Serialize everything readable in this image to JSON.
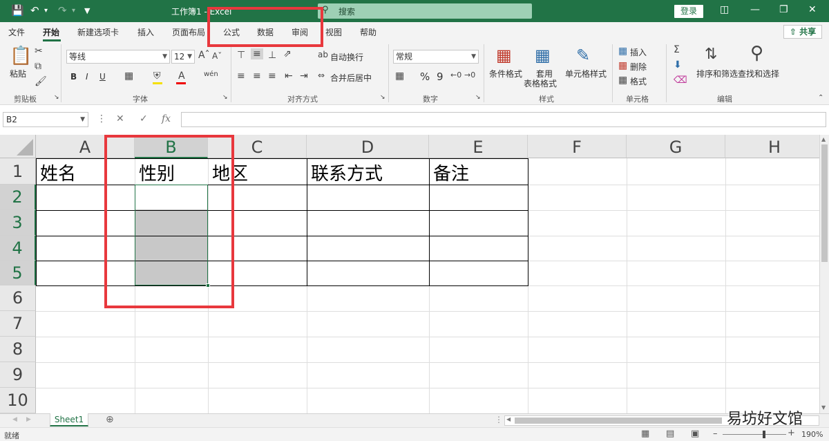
{
  "titlebar": {
    "title": "工作簿1 - Excel",
    "search_icon": "search-icon",
    "search_placeholder": "搜索",
    "login_label": "登录",
    "accent_color": "#217346"
  },
  "tabs": {
    "items": [
      "文件",
      "开始",
      "新建选项卡",
      "插入",
      "页面布局",
      "公式",
      "数据",
      "审阅",
      "视图",
      "帮助"
    ],
    "active": "开始",
    "share_label": "共享"
  },
  "ribbon": {
    "clipboard": {
      "paste": "粘贴",
      "group": "剪贴板"
    },
    "font": {
      "name": "等线",
      "size": "12",
      "bold": "B",
      "italic": "I",
      "underline": "U",
      "group": "字体"
    },
    "alignment": {
      "wrap": "自动换行",
      "merge": "合并后居中",
      "group": "对齐方式"
    },
    "number": {
      "format": "常规",
      "percent": "%",
      "comma": "9",
      "group": "数字"
    },
    "styles": {
      "conditional": "条件格式",
      "table_line1": "套用",
      "table_line2": "表格格式",
      "cell_styles": "单元格样式",
      "group": "样式"
    },
    "cells": {
      "insert": "插入",
      "delete": "删除",
      "format": "格式",
      "group": "单元格"
    },
    "editing": {
      "sort": "排序和筛选",
      "find": "查找和选择",
      "group": "编辑"
    }
  },
  "formula_bar": {
    "name_box": "B2",
    "fx": "fx",
    "value": ""
  },
  "sheet": {
    "columns": [
      "A",
      "B",
      "C",
      "D",
      "E",
      "F",
      "G",
      "H"
    ],
    "rows": [
      "1",
      "2",
      "3",
      "4",
      "5",
      "6",
      "7",
      "8",
      "9",
      "10"
    ],
    "selected_column": "B",
    "selected_rows": [
      "2",
      "3",
      "4",
      "5"
    ],
    "cells": {
      "A1": "姓名",
      "B1": "性别",
      "C1": "地区",
      "D1": "联系方式",
      "E1": "备注"
    },
    "tab_name": "Sheet1"
  },
  "status": {
    "ready": "就绪",
    "zoom": "190%"
  },
  "watermark": "易坊好文馆",
  "annotation_color": "#e8383d"
}
